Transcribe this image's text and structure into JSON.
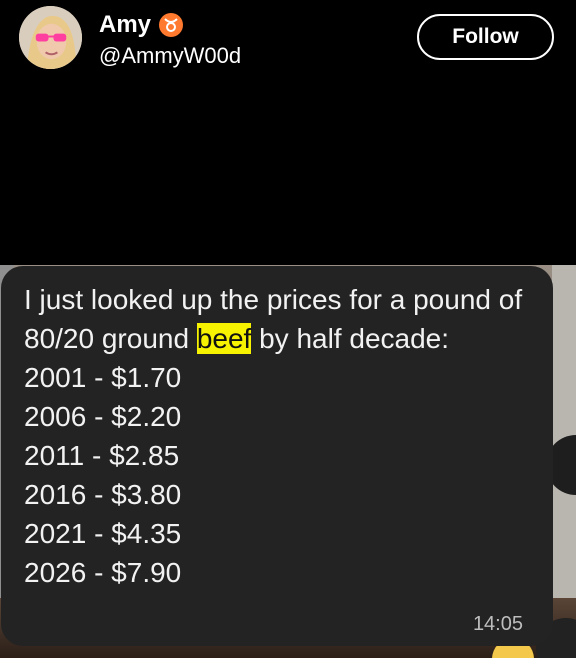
{
  "profile": {
    "name": "Amy",
    "badge_icon": "taurus-icon",
    "handle": "@AmmyW00d",
    "follow_label": "Follow"
  },
  "message": {
    "intro_before": "I just looked up the prices for a pound of 80/20 ground ",
    "highlight": "beef",
    "intro_after": " by half decade:",
    "prices": [
      "2001 - $1.70",
      "2006 - $2.20",
      "2011 - $2.85",
      "2016 - $3.80",
      "2021 - $4.35",
      "2026 - $7.90"
    ],
    "timestamp": "14:05"
  },
  "colors": {
    "badge": "#ff7a2f",
    "highlight": "#f7f300",
    "bubble": "#232323"
  }
}
